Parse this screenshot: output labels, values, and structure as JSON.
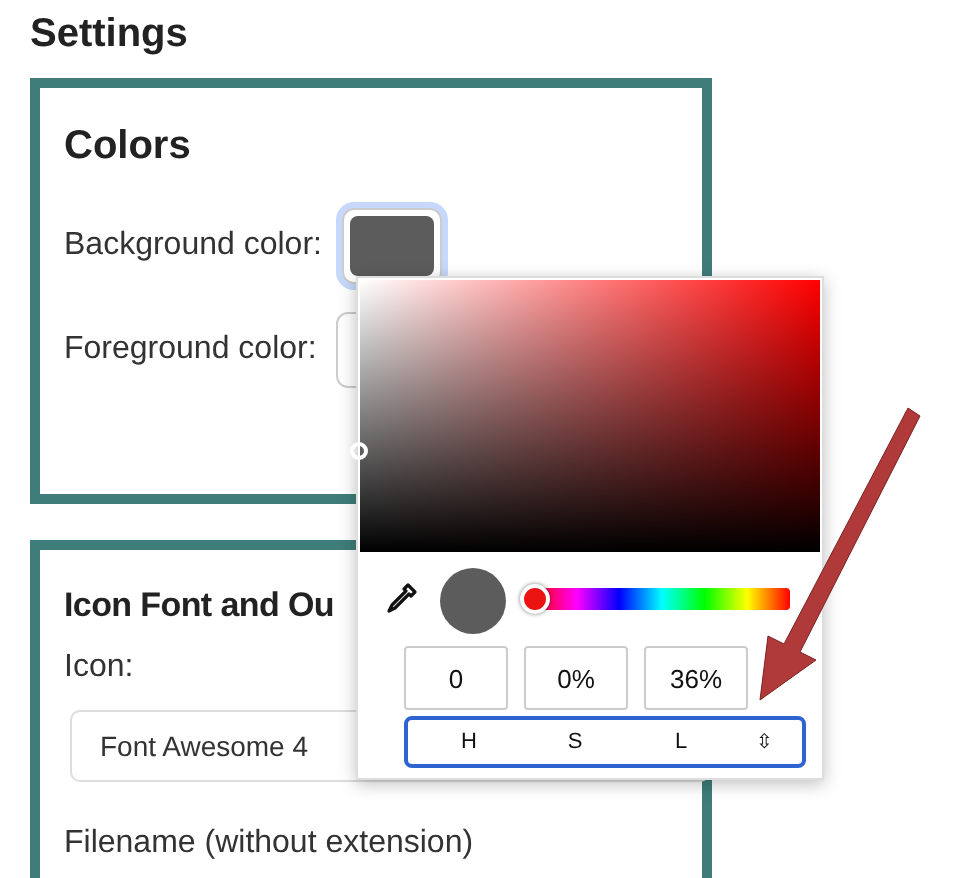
{
  "title": "Settings",
  "colors_panel": {
    "heading": "Colors",
    "items": [
      {
        "label": "Background color:",
        "color": "#5c5c5c",
        "focused": true
      },
      {
        "label": "Foreground color:",
        "focused": false
      }
    ]
  },
  "color_picker": {
    "hue": {
      "level": 0
    },
    "values": [
      "0",
      "0%",
      "36%"
    ],
    "mode": {
      "labels": [
        "H",
        "S",
        "L"
      ],
      "toggle": "⇳"
    }
  },
  "icon_panel": {
    "heading": "Icon Font and Ou",
    "icon_label": "Icon:",
    "icon_select": {
      "value": "Font Awesome 4"
    },
    "filename_label": "Filename (without extension)"
  }
}
